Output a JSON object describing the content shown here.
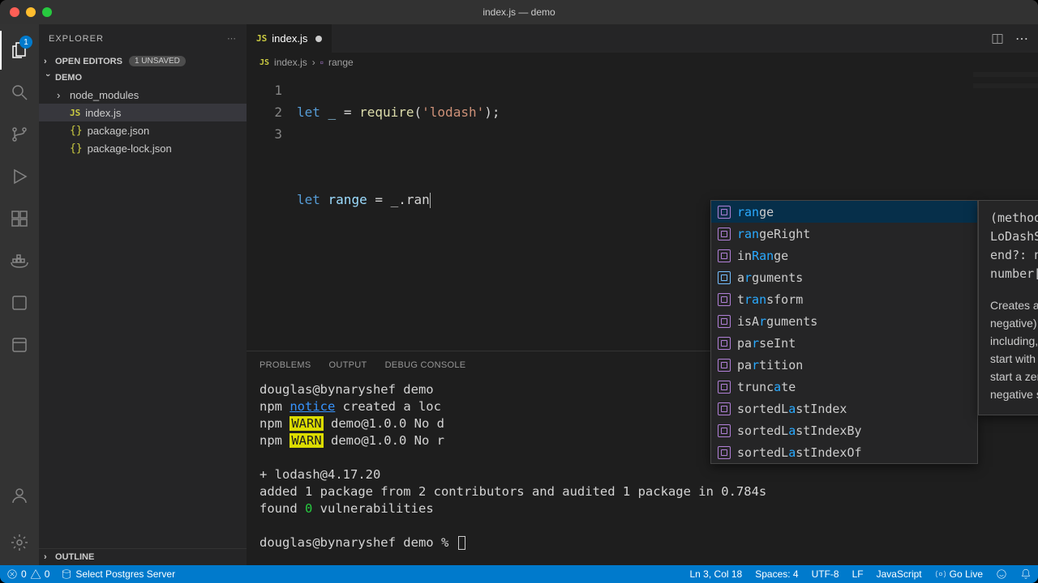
{
  "window": {
    "title": "index.js — demo"
  },
  "activitybar": {
    "explorer_badge": "1"
  },
  "sidebar": {
    "title": "EXPLORER",
    "open_editors": {
      "label": "OPEN EDITORS",
      "unsaved_badge": "1 UNSAVED"
    },
    "folder_name": "DEMO",
    "tree": {
      "node_modules": "node_modules",
      "index_js": "index.js",
      "package_json": "package.json",
      "package_lock": "package-lock.json"
    },
    "outline_label": "OUTLINE"
  },
  "tabs": {
    "index_js": "index.js"
  },
  "breadcrumb": {
    "file": "index.js",
    "symbol": "range"
  },
  "editor": {
    "line_numbers": [
      "1",
      "2",
      "3"
    ],
    "line1": {
      "kw": "let",
      "id": " _ ",
      "eq": "= ",
      "fn": "require",
      "open": "(",
      "str": "'lodash'",
      "close": ");"
    },
    "line3": {
      "kw": "let",
      "id": " range ",
      "eq": "= _.",
      "partial": "ran"
    }
  },
  "suggest": {
    "items": [
      {
        "pre": "",
        "hl": "ran",
        "post": "ge",
        "icon": "method",
        "selected": true
      },
      {
        "pre": "",
        "hl": "ran",
        "post": "geRight",
        "icon": "method"
      },
      {
        "pre": "in",
        "hl": "Ran",
        "post": "ge",
        "icon": "method"
      },
      {
        "pre": "a",
        "hl": "r",
        "post": "guments",
        "icon": "var",
        "hl2": null
      },
      {
        "pre": "t",
        "hl": "ran",
        "post": "sform",
        "icon": "method"
      },
      {
        "pre": "isA",
        "hl": "r",
        "post": "guments",
        "icon": "method"
      },
      {
        "pre": "pa",
        "hl": "r",
        "post": "seInt",
        "icon": "method"
      },
      {
        "pre": "pa",
        "hl": "r",
        "post": "tition",
        "icon": "method"
      },
      {
        "pre": "trunc",
        "hl": "a",
        "post": "te",
        "icon": "method"
      },
      {
        "pre": "sortedL",
        "hl": "a",
        "post": "stIndex",
        "icon": "method"
      },
      {
        "pre": "sortedL",
        "hl": "a",
        "post": "stIndexBy",
        "icon": "method"
      },
      {
        "pre": "sortedL",
        "hl": "a",
        "post": "stIndexOf",
        "icon": "method"
      }
    ],
    "doc": {
      "signature": "(method) LoDashStatic.range(start: number, end?: number, step?: number): number[] (+1 overload)",
      "description": "Creates an array of numbers (positive and/or negative) progressing from start up to, but not including, end. If end is not specified it's set to start with start then set to 0. If end is less than start a zero-length range is created unless a negative step is specified."
    }
  },
  "panel": {
    "tabs": {
      "problems": "PROBLEMS",
      "output": "OUTPUT",
      "debug": "DEBUG CONSOLE"
    },
    "terminal": {
      "l1_a": "douglas@bynaryshef demo ",
      "l2_a": "npm ",
      "l2_notice": "notice",
      "l2_b": " created a loc",
      "l3_a": "npm ",
      "l3_warn": "WARN",
      "l3_b": " demo@1.0.0 No d",
      "l4_a": "npm ",
      "l4_warn": "WARN",
      "l4_b": " demo@1.0.0 No r",
      "l5": "+ lodash@4.17.20",
      "l6": "added 1 package from 2 contributors and audited 1 package in 0.784s",
      "l7_a": "found ",
      "l7_zero": "0",
      "l7_b": " vulnerabilities",
      "prompt": "douglas@bynaryshef demo % "
    }
  },
  "statusbar": {
    "errors": "0",
    "warnings": "0",
    "postgres": "Select Postgres Server",
    "ln_col": "Ln 3, Col 18",
    "spaces": "Spaces: 4",
    "encoding": "UTF-8",
    "eol": "LF",
    "lang": "JavaScript",
    "golive": "Go Live"
  }
}
